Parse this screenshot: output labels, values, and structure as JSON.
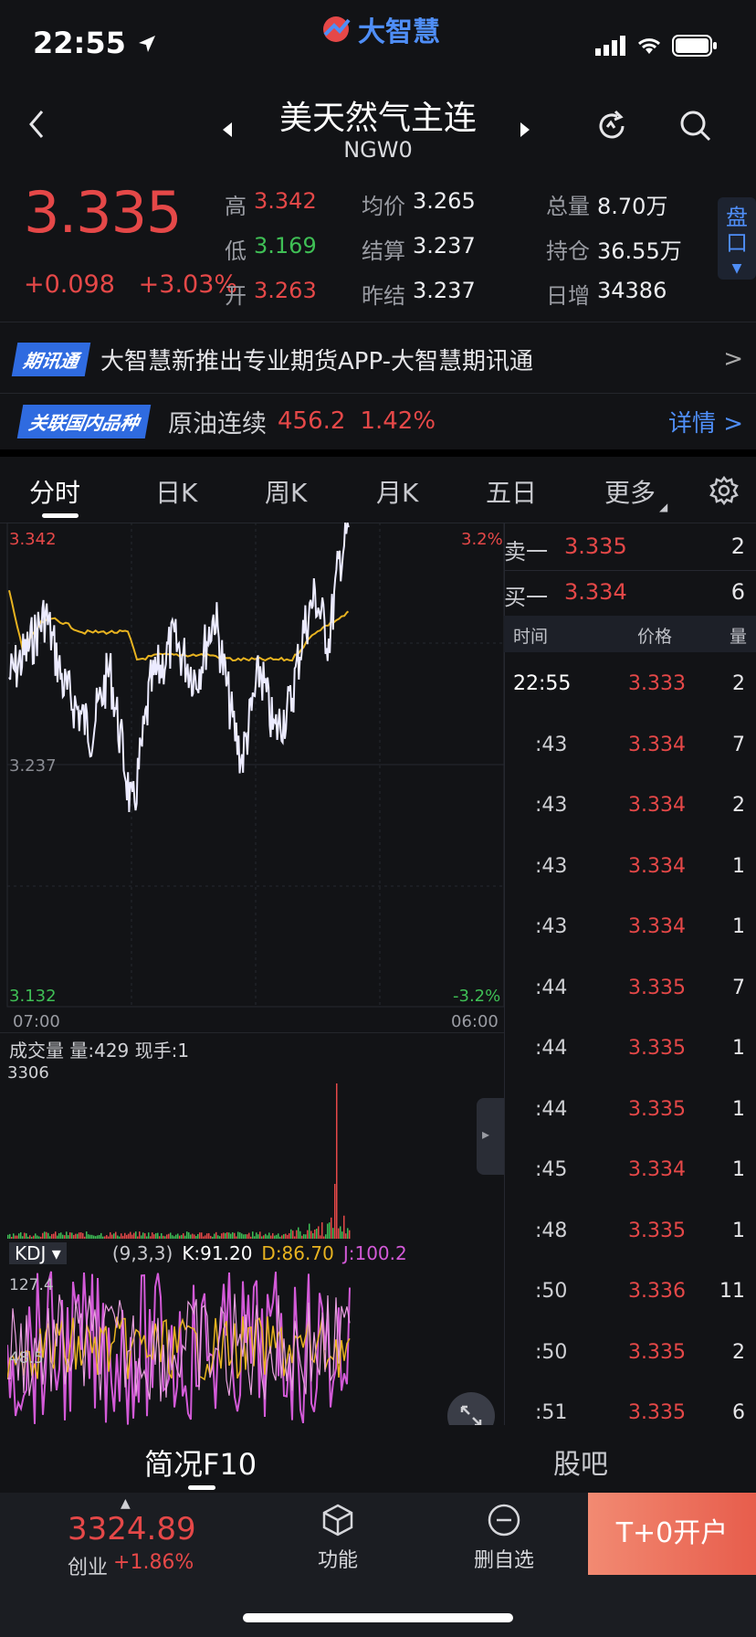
{
  "status_bar": {
    "time": "22:55"
  },
  "app": {
    "logo_text": "大智慧"
  },
  "header": {
    "title": "美天然气主连",
    "code": "NGW0"
  },
  "quote": {
    "last_price": "3.335",
    "change": "+0.098",
    "change_pct": "+3.03%",
    "high_label": "高",
    "high": "3.342",
    "low_label": "低",
    "low": "3.169",
    "open_label": "开",
    "open": "3.263",
    "avg_label": "均价",
    "avg": "3.265",
    "settle_label": "结算",
    "settle": "3.237",
    "prev_settle_label": "昨结",
    "prev_settle": "3.237",
    "total_vol_label": "总量",
    "total_vol": "8.70万",
    "open_interest_label": "持仓",
    "open_interest": "36.55万",
    "daily_inc_label": "日增",
    "daily_inc": "34386",
    "pankou_label": "盘口"
  },
  "news_banner": {
    "badge": "期讯通",
    "text": "大智慧新推出专业期货APP-大智慧期讯通",
    "arrow": ">"
  },
  "related": {
    "badge": "关联国内品种",
    "name": "原油连续",
    "price": "456.2",
    "pct": "1.42%",
    "detail": "详情 >"
  },
  "tabs": [
    "分时",
    "日K",
    "周K",
    "月K",
    "五日",
    "更多"
  ],
  "chart": {
    "top_price": "3.342",
    "top_pct": "3.2%",
    "mid_price": "3.237",
    "bottom_price": "3.132",
    "bottom_pct": "-3.2%",
    "time_start": "07:00",
    "time_end": "06:00"
  },
  "volume": {
    "title": "成交量  量:429  现手:1",
    "max": "3306"
  },
  "kdj": {
    "selector": "KDJ ▾",
    "params": "(9,3,3)",
    "k": "K:91.20",
    "d": "D:86.70",
    "j": "J:100.2",
    "top": "127.4",
    "mid": "48.5"
  },
  "order_book": {
    "ask": {
      "label": "卖一",
      "price": "3.335",
      "qty": "2"
    },
    "bid": {
      "label": "买一",
      "price": "3.334",
      "qty": "6"
    }
  },
  "ticks": {
    "headers": [
      "时间",
      "价格",
      "量"
    ],
    "rows": [
      {
        "time": "22:55",
        "price": "3.333",
        "qty": "2"
      },
      {
        "time": ":43",
        "price": "3.334",
        "qty": "7"
      },
      {
        "time": ":43",
        "price": "3.334",
        "qty": "2"
      },
      {
        "time": ":43",
        "price": "3.334",
        "qty": "1"
      },
      {
        "time": ":43",
        "price": "3.334",
        "qty": "1"
      },
      {
        "time": ":44",
        "price": "3.335",
        "qty": "7"
      },
      {
        "time": ":44",
        "price": "3.335",
        "qty": "1"
      },
      {
        "time": ":44",
        "price": "3.335",
        "qty": "1"
      },
      {
        "time": ":45",
        "price": "3.334",
        "qty": "1"
      },
      {
        "time": ":48",
        "price": "3.335",
        "qty": "1"
      },
      {
        "time": ":50",
        "price": "3.336",
        "qty": "11"
      },
      {
        "time": ":50",
        "price": "3.335",
        "qty": "2"
      },
      {
        "time": ":51",
        "price": "3.335",
        "qty": "6"
      }
    ]
  },
  "info_tabs": {
    "f10": "简况F10",
    "forum": "股吧"
  },
  "bottom_bar": {
    "index_value": "3324.89",
    "index_name": "创业",
    "index_change": "+1.86%",
    "func": "功能",
    "del_fav": "删自选",
    "open_account": "T+0开户"
  },
  "colors": {
    "up": "#e54848",
    "down": "#3fbf55",
    "accent": "#4f8ef7",
    "avg_line": "#e8b320",
    "price_line": "#e9e9ff"
  }
}
